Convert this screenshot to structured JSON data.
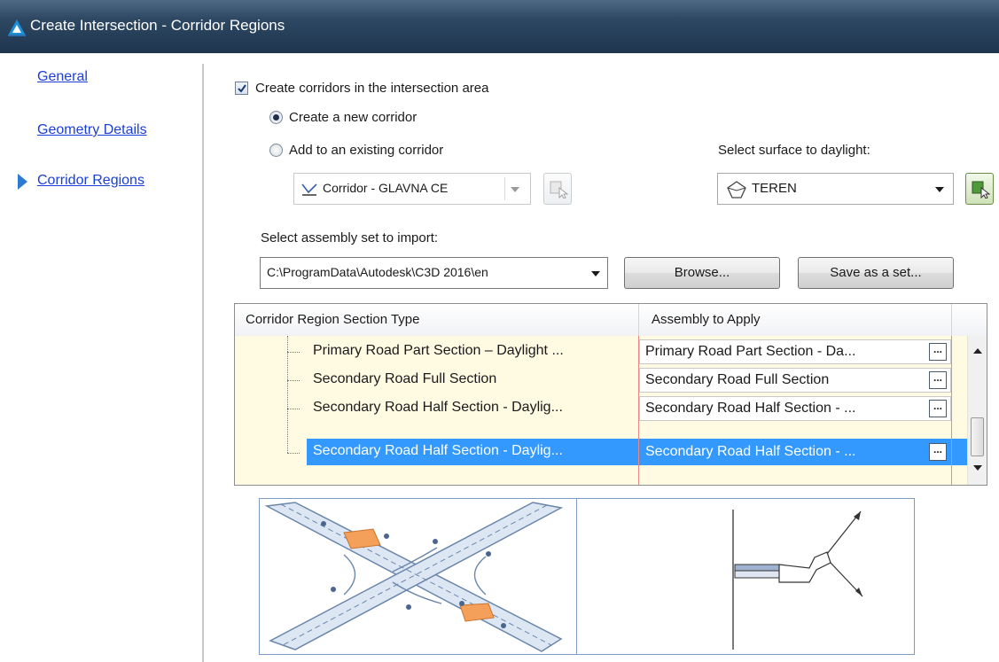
{
  "window": {
    "title": "Create Intersection - Corridor Regions"
  },
  "nav": {
    "items": [
      {
        "label": "General"
      },
      {
        "label": "Geometry Details"
      },
      {
        "label": "Corridor Regions"
      }
    ],
    "active": "Corridor Regions"
  },
  "options": {
    "create_corridors_label": "Create corridors in the intersection area",
    "create_corridors_checked": true,
    "new_corridor_label": "Create a new corridor",
    "existing_corridor_label": "Add to an existing corridor",
    "selected_option": "Create a new corridor",
    "existing_corridor_value": "Corridor - GLAVNA CE",
    "surface_label": "Select surface to daylight:",
    "surface_value": "TEREN",
    "assembly_set_label": "Select assembly set to import:",
    "assembly_set_path": "C:\\ProgramData\\Autodesk\\C3D 2016\\en",
    "browse_label": "Browse...",
    "save_set_label": "Save as a set..."
  },
  "grid": {
    "columns": [
      "Corridor Region Section Type",
      "Assembly to Apply"
    ],
    "rows": [
      {
        "section_type": "Primary Road Part Section – Daylight ...",
        "assembly": "Primary Road Part Section - Da...",
        "selected": false
      },
      {
        "section_type": "Secondary Road Full Section",
        "assembly": "Secondary Road Full Section",
        "selected": false
      },
      {
        "section_type": "Secondary Road Half Section - Daylig...",
        "assembly": "Secondary Road Half Section - ...",
        "selected": false
      },
      {
        "section_type": "Secondary Road Half Section - Daylig...",
        "assembly": "Secondary Road Half Section - ...",
        "selected": true
      }
    ],
    "ellipsis_label": "..."
  },
  "colors": {
    "titlebar": "#2e4863",
    "link": "#1a3fd4",
    "selection": "#3399ff",
    "grid_bg": "#fffbe3",
    "highlight_region": "#f4a05a",
    "road_fill": "#dde7f4",
    "road_stroke": "#6b86ab"
  },
  "icons": [
    "autocad-app-icon",
    "check-icon",
    "corridor-icon",
    "pick-from-drawing-icon",
    "surface-icon",
    "dropdown-arrow-icon",
    "ellipsis-button-icon",
    "scroll-up-icon",
    "scroll-down-icon"
  ]
}
